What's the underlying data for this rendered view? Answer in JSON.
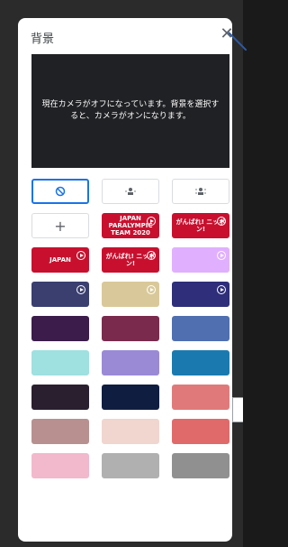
{
  "panel": {
    "title": "背景",
    "close_icon": "close-icon",
    "preview_text": "現在カメラがオフになっています。背景を選択すると、カメラがオンになります。"
  },
  "options": {
    "none_icon": "no-background-icon",
    "blur_slight_icon": "slight-blur-icon",
    "blur_full_icon": "blur-icon",
    "add_icon": "plus-icon",
    "add_label": "+"
  },
  "tiles": [
    {
      "text": "JAPAN PARALYMPIC TEAM 2020",
      "color": "#c8102e",
      "video": true
    },
    {
      "text": "がんばれ! ニッポン!",
      "color": "#c8102e",
      "video": true
    },
    {
      "text": "JAPAN",
      "color": "#c8102e",
      "video": true
    },
    {
      "text": "がんばれ! ニッポン!",
      "color": "#c8102e",
      "video": true
    },
    {
      "text": "",
      "color": "#e0b0ff",
      "video": true
    },
    {
      "text": "",
      "color": "#3a3f70",
      "video": true
    },
    {
      "text": "",
      "color": "#d9c99a",
      "video": true
    },
    {
      "text": "",
      "color": "#2e2e7a",
      "video": true
    },
    {
      "text": "",
      "color": "#3b1c4a",
      "video": false
    },
    {
      "text": "",
      "color": "#7a2a4d",
      "video": false
    },
    {
      "text": "",
      "color": "#4f6fb0",
      "video": false
    },
    {
      "text": "",
      "color": "#9fe0e0",
      "video": false
    },
    {
      "text": "",
      "color": "#9a8ad6",
      "video": false
    },
    {
      "text": "",
      "color": "#1a7ab0",
      "video": false
    },
    {
      "text": "",
      "color": "#2a1f2f",
      "video": false
    },
    {
      "text": "",
      "color": "#0f1e40",
      "video": false
    },
    {
      "text": "",
      "color": "#e07a7a",
      "video": false
    },
    {
      "text": "",
      "color": "#b89090",
      "video": false
    },
    {
      "text": "",
      "color": "#f0d6cf",
      "video": false
    },
    {
      "text": "",
      "color": "#e06a6a",
      "video": false
    },
    {
      "text": "",
      "color": "#f2b8cc",
      "video": false
    },
    {
      "text": "",
      "color": "#b0b0b0",
      "video": false
    },
    {
      "text": "",
      "color": "#909090",
      "video": false
    }
  ]
}
